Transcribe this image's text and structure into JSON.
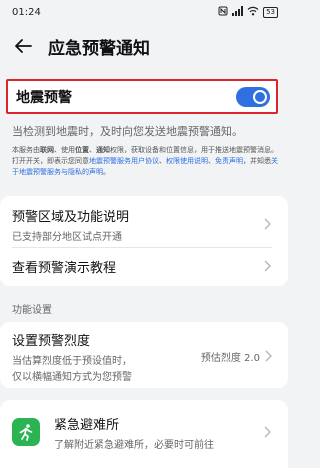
{
  "status_bar": {
    "time": "01:24",
    "battery": "53"
  },
  "header": {
    "title": "应急预警通知"
  },
  "earthquake_toggle": {
    "label": "地震预警",
    "enabled": true,
    "accent": "#2f6fe0",
    "highlight": "#d9252b"
  },
  "description": "当检测到地震时，及时向您发送地震预警通知。",
  "fine_print": {
    "p1": "本服务由",
    "b1": "联网",
    "p2": "、使用",
    "b2": "位置",
    "p3": "、",
    "b3": "通知",
    "p4": "权限，获取设备和位置信息，用于推送地震预警消息。打开开关，即表示您同意",
    "l1": "地震预警服务用户协议",
    "p5": "、",
    "l2": "权限使用说明",
    "p6": "、",
    "l3": "免责声明",
    "p7": "，并知悉",
    "l4": "关于地震预警服务与隐私的声明",
    "p8": "。"
  },
  "list1": {
    "item1": {
      "title": "预警区域及功能说明",
      "subtitle": "已支持部分地区试点开通"
    },
    "item2": {
      "title": "查看预警演示教程"
    }
  },
  "section_label": "功能设置",
  "level": {
    "title": "设置预警烈度",
    "subtitle_line1": "当估算烈度低于预设值时，",
    "subtitle_line2": "仅以横幅通知方式为您预警",
    "value": "预估烈度 2.0"
  },
  "shelter": {
    "title": "紧急避难所",
    "subtitle": "了解附近紧急避难所，必要时可前往",
    "icon_color": "#2bb354"
  }
}
